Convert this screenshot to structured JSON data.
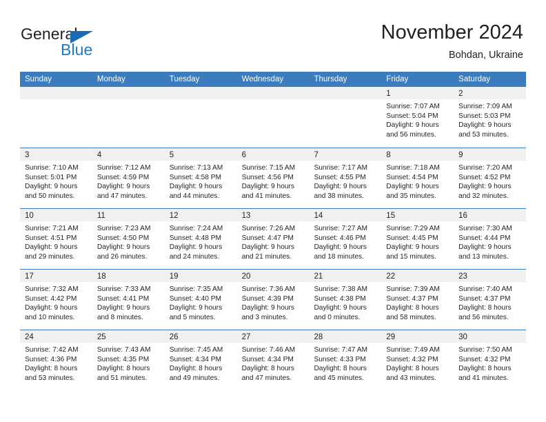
{
  "logo": {
    "word_primary": "General",
    "word_secondary": "Blue",
    "triangle_color": "#1c6cb4",
    "secondary_color": "#1c7bc4"
  },
  "header": {
    "title": "November 2024",
    "subtitle": "Bohdan, Ukraine"
  },
  "theme": {
    "header_bar_color": "#3a7cbe",
    "day_band_color": "#f0f0f0",
    "text_color": "#231f20"
  },
  "weekdays": [
    "Sunday",
    "Monday",
    "Tuesday",
    "Wednesday",
    "Thursday",
    "Friday",
    "Saturday"
  ],
  "weeks": [
    [
      {
        "day": "",
        "blank": true,
        "sunrise": "",
        "sunset": "",
        "daylight_line1": "",
        "daylight_line2": ""
      },
      {
        "day": "",
        "blank": true,
        "sunrise": "",
        "sunset": "",
        "daylight_line1": "",
        "daylight_line2": ""
      },
      {
        "day": "",
        "blank": true,
        "sunrise": "",
        "sunset": "",
        "daylight_line1": "",
        "daylight_line2": ""
      },
      {
        "day": "",
        "blank": true,
        "sunrise": "",
        "sunset": "",
        "daylight_line1": "",
        "daylight_line2": ""
      },
      {
        "day": "",
        "blank": true,
        "sunrise": "",
        "sunset": "",
        "daylight_line1": "",
        "daylight_line2": ""
      },
      {
        "day": "1",
        "blank": false,
        "sunrise": "Sunrise: 7:07 AM",
        "sunset": "Sunset: 5:04 PM",
        "daylight_line1": "Daylight: 9 hours",
        "daylight_line2": "and 56 minutes."
      },
      {
        "day": "2",
        "blank": false,
        "sunrise": "Sunrise: 7:09 AM",
        "sunset": "Sunset: 5:03 PM",
        "daylight_line1": "Daylight: 9 hours",
        "daylight_line2": "and 53 minutes."
      }
    ],
    [
      {
        "day": "3",
        "blank": false,
        "sunrise": "Sunrise: 7:10 AM",
        "sunset": "Sunset: 5:01 PM",
        "daylight_line1": "Daylight: 9 hours",
        "daylight_line2": "and 50 minutes."
      },
      {
        "day": "4",
        "blank": false,
        "sunrise": "Sunrise: 7:12 AM",
        "sunset": "Sunset: 4:59 PM",
        "daylight_line1": "Daylight: 9 hours",
        "daylight_line2": "and 47 minutes."
      },
      {
        "day": "5",
        "blank": false,
        "sunrise": "Sunrise: 7:13 AM",
        "sunset": "Sunset: 4:58 PM",
        "daylight_line1": "Daylight: 9 hours",
        "daylight_line2": "and 44 minutes."
      },
      {
        "day": "6",
        "blank": false,
        "sunrise": "Sunrise: 7:15 AM",
        "sunset": "Sunset: 4:56 PM",
        "daylight_line1": "Daylight: 9 hours",
        "daylight_line2": "and 41 minutes."
      },
      {
        "day": "7",
        "blank": false,
        "sunrise": "Sunrise: 7:17 AM",
        "sunset": "Sunset: 4:55 PM",
        "daylight_line1": "Daylight: 9 hours",
        "daylight_line2": "and 38 minutes."
      },
      {
        "day": "8",
        "blank": false,
        "sunrise": "Sunrise: 7:18 AM",
        "sunset": "Sunset: 4:54 PM",
        "daylight_line1": "Daylight: 9 hours",
        "daylight_line2": "and 35 minutes."
      },
      {
        "day": "9",
        "blank": false,
        "sunrise": "Sunrise: 7:20 AM",
        "sunset": "Sunset: 4:52 PM",
        "daylight_line1": "Daylight: 9 hours",
        "daylight_line2": "and 32 minutes."
      }
    ],
    [
      {
        "day": "10",
        "blank": false,
        "sunrise": "Sunrise: 7:21 AM",
        "sunset": "Sunset: 4:51 PM",
        "daylight_line1": "Daylight: 9 hours",
        "daylight_line2": "and 29 minutes."
      },
      {
        "day": "11",
        "blank": false,
        "sunrise": "Sunrise: 7:23 AM",
        "sunset": "Sunset: 4:50 PM",
        "daylight_line1": "Daylight: 9 hours",
        "daylight_line2": "and 26 minutes."
      },
      {
        "day": "12",
        "blank": false,
        "sunrise": "Sunrise: 7:24 AM",
        "sunset": "Sunset: 4:48 PM",
        "daylight_line1": "Daylight: 9 hours",
        "daylight_line2": "and 24 minutes."
      },
      {
        "day": "13",
        "blank": false,
        "sunrise": "Sunrise: 7:26 AM",
        "sunset": "Sunset: 4:47 PM",
        "daylight_line1": "Daylight: 9 hours",
        "daylight_line2": "and 21 minutes."
      },
      {
        "day": "14",
        "blank": false,
        "sunrise": "Sunrise: 7:27 AM",
        "sunset": "Sunset: 4:46 PM",
        "daylight_line1": "Daylight: 9 hours",
        "daylight_line2": "and 18 minutes."
      },
      {
        "day": "15",
        "blank": false,
        "sunrise": "Sunrise: 7:29 AM",
        "sunset": "Sunset: 4:45 PM",
        "daylight_line1": "Daylight: 9 hours",
        "daylight_line2": "and 15 minutes."
      },
      {
        "day": "16",
        "blank": false,
        "sunrise": "Sunrise: 7:30 AM",
        "sunset": "Sunset: 4:44 PM",
        "daylight_line1": "Daylight: 9 hours",
        "daylight_line2": "and 13 minutes."
      }
    ],
    [
      {
        "day": "17",
        "blank": false,
        "sunrise": "Sunrise: 7:32 AM",
        "sunset": "Sunset: 4:42 PM",
        "daylight_line1": "Daylight: 9 hours",
        "daylight_line2": "and 10 minutes."
      },
      {
        "day": "18",
        "blank": false,
        "sunrise": "Sunrise: 7:33 AM",
        "sunset": "Sunset: 4:41 PM",
        "daylight_line1": "Daylight: 9 hours",
        "daylight_line2": "and 8 minutes."
      },
      {
        "day": "19",
        "blank": false,
        "sunrise": "Sunrise: 7:35 AM",
        "sunset": "Sunset: 4:40 PM",
        "daylight_line1": "Daylight: 9 hours",
        "daylight_line2": "and 5 minutes."
      },
      {
        "day": "20",
        "blank": false,
        "sunrise": "Sunrise: 7:36 AM",
        "sunset": "Sunset: 4:39 PM",
        "daylight_line1": "Daylight: 9 hours",
        "daylight_line2": "and 3 minutes."
      },
      {
        "day": "21",
        "blank": false,
        "sunrise": "Sunrise: 7:38 AM",
        "sunset": "Sunset: 4:38 PM",
        "daylight_line1": "Daylight: 9 hours",
        "daylight_line2": "and 0 minutes."
      },
      {
        "day": "22",
        "blank": false,
        "sunrise": "Sunrise: 7:39 AM",
        "sunset": "Sunset: 4:37 PM",
        "daylight_line1": "Daylight: 8 hours",
        "daylight_line2": "and 58 minutes."
      },
      {
        "day": "23",
        "blank": false,
        "sunrise": "Sunrise: 7:40 AM",
        "sunset": "Sunset: 4:37 PM",
        "daylight_line1": "Daylight: 8 hours",
        "daylight_line2": "and 56 minutes."
      }
    ],
    [
      {
        "day": "24",
        "blank": false,
        "sunrise": "Sunrise: 7:42 AM",
        "sunset": "Sunset: 4:36 PM",
        "daylight_line1": "Daylight: 8 hours",
        "daylight_line2": "and 53 minutes."
      },
      {
        "day": "25",
        "blank": false,
        "sunrise": "Sunrise: 7:43 AM",
        "sunset": "Sunset: 4:35 PM",
        "daylight_line1": "Daylight: 8 hours",
        "daylight_line2": "and 51 minutes."
      },
      {
        "day": "26",
        "blank": false,
        "sunrise": "Sunrise: 7:45 AM",
        "sunset": "Sunset: 4:34 PM",
        "daylight_line1": "Daylight: 8 hours",
        "daylight_line2": "and 49 minutes."
      },
      {
        "day": "27",
        "blank": false,
        "sunrise": "Sunrise: 7:46 AM",
        "sunset": "Sunset: 4:34 PM",
        "daylight_line1": "Daylight: 8 hours",
        "daylight_line2": "and 47 minutes."
      },
      {
        "day": "28",
        "blank": false,
        "sunrise": "Sunrise: 7:47 AM",
        "sunset": "Sunset: 4:33 PM",
        "daylight_line1": "Daylight: 8 hours",
        "daylight_line2": "and 45 minutes."
      },
      {
        "day": "29",
        "blank": false,
        "sunrise": "Sunrise: 7:49 AM",
        "sunset": "Sunset: 4:32 PM",
        "daylight_line1": "Daylight: 8 hours",
        "daylight_line2": "and 43 minutes."
      },
      {
        "day": "30",
        "blank": false,
        "sunrise": "Sunrise: 7:50 AM",
        "sunset": "Sunset: 4:32 PM",
        "daylight_line1": "Daylight: 8 hours",
        "daylight_line2": "and 41 minutes."
      }
    ]
  ]
}
